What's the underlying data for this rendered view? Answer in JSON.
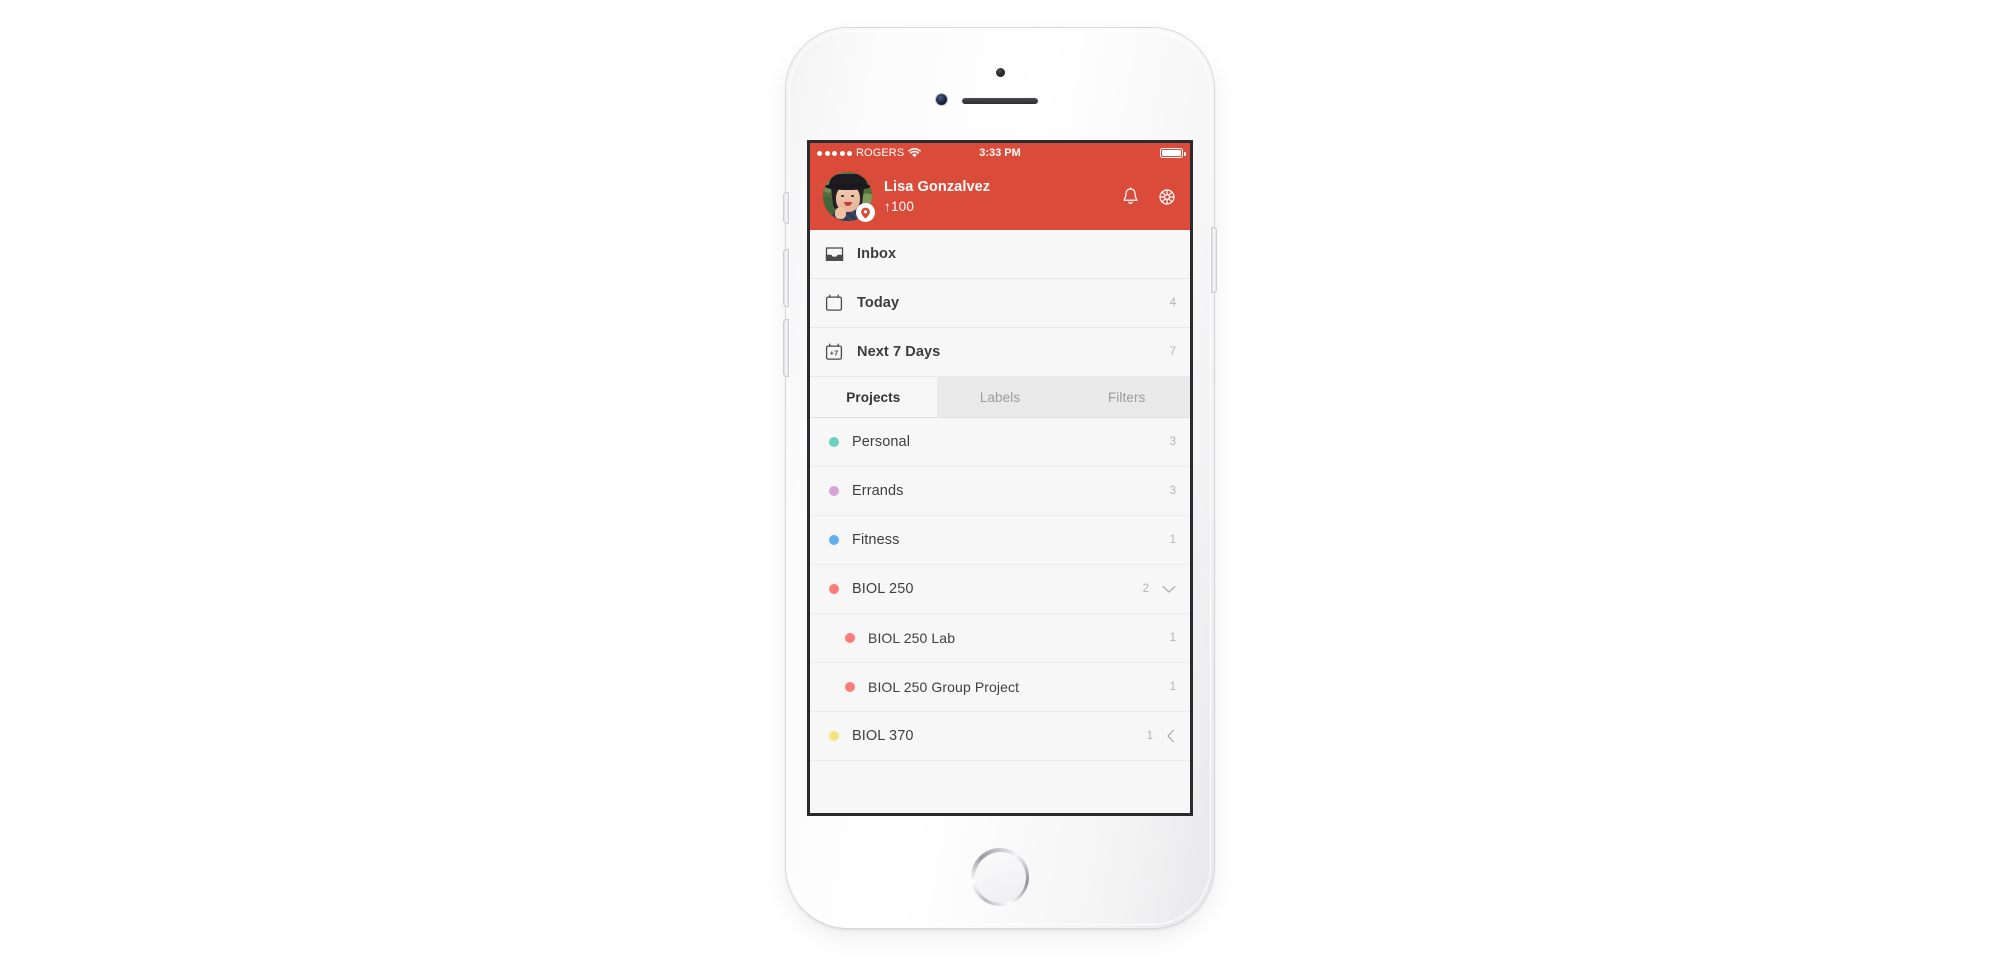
{
  "device": {
    "name": "iphone-mockup",
    "color": "#ffffff"
  },
  "status_bar": {
    "signal_dots": 5,
    "carrier": "ROGERS",
    "wifi_icon": "wifi-icon",
    "time": "3:33 PM",
    "battery_icon": "battery-full-icon",
    "battery_level": 100
  },
  "header": {
    "background": "#db4b3a",
    "avatar": {
      "icon": "avatar",
      "badge_icon": "location-pin-badge-icon"
    },
    "user_name": "Lisa Gonzalvez",
    "karma": "↑100",
    "actions": [
      {
        "name": "notifications-button",
        "icon": "bell-icon"
      },
      {
        "name": "settings-button",
        "icon": "gear-icon"
      }
    ]
  },
  "nav": {
    "items": [
      {
        "name": "inbox",
        "icon": "inbox-icon",
        "label": "Inbox",
        "count": ""
      },
      {
        "name": "today",
        "icon": "calendar-icon",
        "label": "Today",
        "count": "4"
      },
      {
        "name": "next-7-days",
        "icon": "calendar-plus-7-icon",
        "label": "Next 7 Days",
        "count": "7"
      }
    ]
  },
  "tabs": {
    "items": [
      {
        "name": "tab-projects",
        "label": "Projects",
        "active": true
      },
      {
        "name": "tab-labels",
        "label": "Labels",
        "active": false
      },
      {
        "name": "tab-filters",
        "label": "Filters",
        "active": false
      }
    ]
  },
  "projects": {
    "items": [
      {
        "name": "project-personal",
        "label": "Personal",
        "count": "3",
        "color": "#68d3bd",
        "indent": false,
        "chevron": ""
      },
      {
        "name": "project-errands",
        "label": "Errands",
        "count": "3",
        "color": "#d9a3da",
        "indent": false,
        "chevron": ""
      },
      {
        "name": "project-fitness",
        "label": "Fitness",
        "count": "1",
        "color": "#62aef0",
        "indent": false,
        "chevron": ""
      },
      {
        "name": "project-biol-250",
        "label": "BIOL 250",
        "count": "2",
        "color": "#fc7d77",
        "indent": false,
        "chevron": "chevron-down-icon"
      },
      {
        "name": "project-biol-250-lab",
        "label": "BIOL 250 Lab",
        "count": "1",
        "color": "#fc7d77",
        "indent": true,
        "chevron": ""
      },
      {
        "name": "project-biol-250-group-project",
        "label": "BIOL 250 Group Project",
        "count": "1",
        "color": "#fc7d77",
        "indent": true,
        "chevron": ""
      },
      {
        "name": "project-biol-370",
        "label": "BIOL 370",
        "count": "1",
        "color": "#f4e47d",
        "indent": false,
        "chevron": "chevron-left-icon"
      }
    ]
  }
}
